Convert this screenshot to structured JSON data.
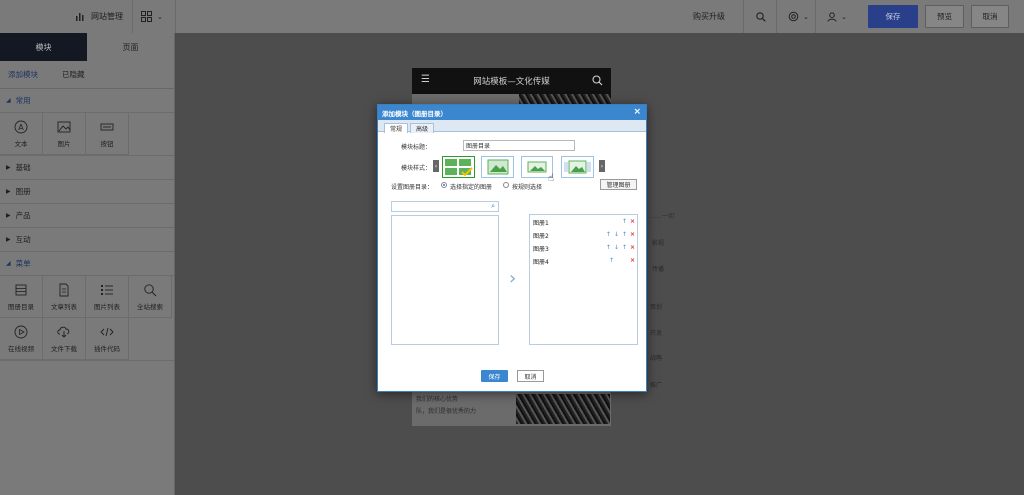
{
  "topbar": {
    "website_manage": "网站管理",
    "buy_upgrade": "购买升级",
    "save": "保存",
    "preview": "预览",
    "cancel": "取消"
  },
  "sidebar": {
    "tabs": [
      "模块",
      "页面"
    ],
    "sub_tabs": [
      "添加模块",
      "已隐藏"
    ],
    "common_category": "常用",
    "common_items": [
      "文本",
      "图片",
      "按钮"
    ],
    "categories": [
      "基础",
      "图册",
      "产品",
      "互动"
    ],
    "open_category": "菜单",
    "open_items": [
      "图册目录",
      "文章列表",
      "图片列表",
      "全站搜索",
      "在线视频",
      "文件下载",
      "插件代码"
    ]
  },
  "site": {
    "header_title": "网站模板—文化传媒",
    "ghost_texts": [
      "……一切",
      "影视",
      "传播",
      "策划",
      "开发",
      "推广",
      "战略",
      "推广"
    ],
    "footer_lines": [
      "我们的核心优势",
      "队，我们是很优秀的力"
    ]
  },
  "dialog": {
    "title": "添加模块（图册目录）",
    "tabs": [
      "常规",
      "高级"
    ],
    "label_title": "模块标题：",
    "title_value": "图册目录",
    "label_style": "模块样式：",
    "label_setting": "设置图册目录：",
    "radio_options": [
      "选择指定的图册",
      "按规则选择"
    ],
    "manage_button": "管理图册",
    "selected_items": [
      "图册1",
      "图册2",
      "图册3",
      "图册4"
    ],
    "save_button": "保存",
    "cancel_button": "取消"
  }
}
